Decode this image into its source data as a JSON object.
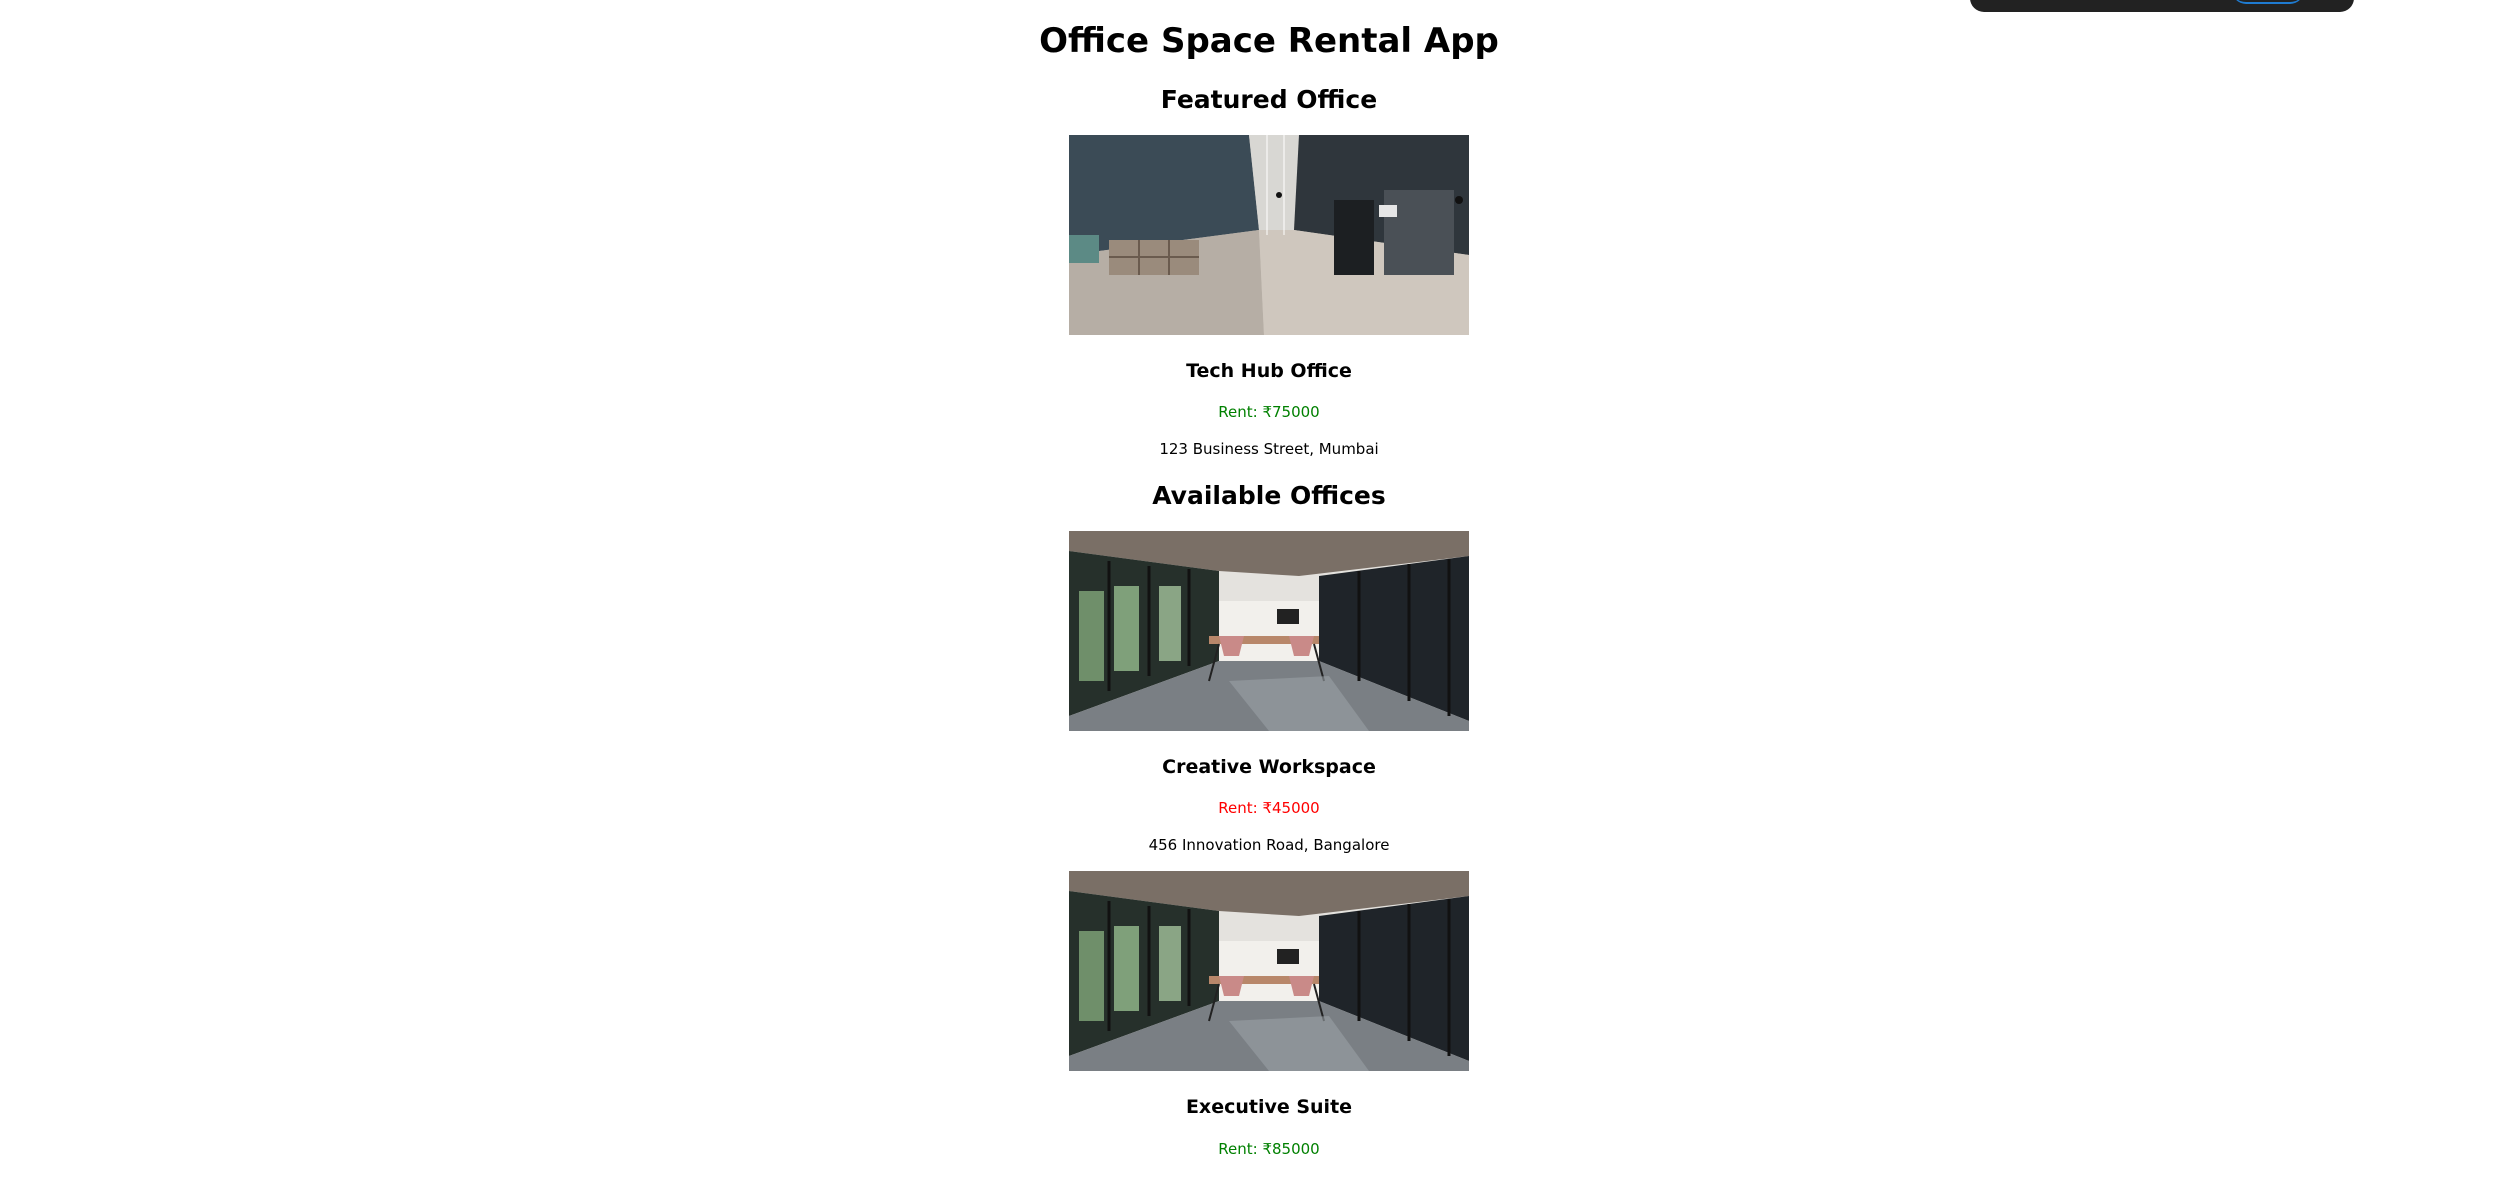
{
  "app": {
    "title": "Office Space Rental App"
  },
  "featured": {
    "heading": "Featured Office",
    "office": {
      "name": "Tech Hub Office",
      "rent": "Rent: ₹75000",
      "rent_color": "#008000",
      "address": "123 Business Street, Mumbai",
      "image": "office-interior-photo"
    }
  },
  "available": {
    "heading": "Available Offices",
    "offices": [
      {
        "name": "Creative Workspace",
        "rent": "Rent: ₹45000",
        "rent_color": "#ff0000",
        "address": "456 Innovation Road, Bangalore",
        "image": "conference-room-photo"
      },
      {
        "name": "Executive Suite",
        "rent": "Rent: ₹85000",
        "rent_color": "#008000",
        "image": "conference-room-photo"
      }
    ]
  }
}
